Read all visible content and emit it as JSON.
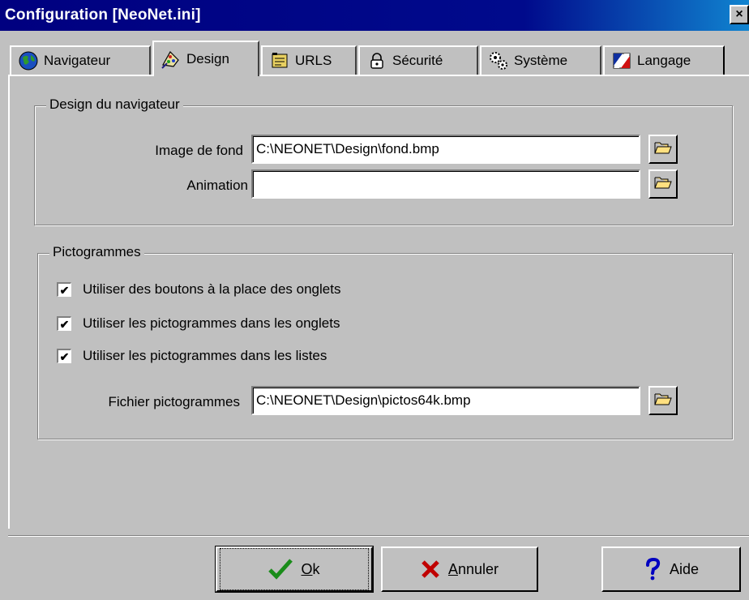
{
  "window": {
    "title": "Configuration [NeoNet.ini]",
    "close_label": "×"
  },
  "tabs": [
    {
      "label": "Navigateur",
      "icon": "globe-icon",
      "active": false
    },
    {
      "label": "Design",
      "icon": "palette-icon",
      "active": true
    },
    {
      "label": "URLS",
      "icon": "address-book-icon",
      "active": false
    },
    {
      "label": "Sécurité",
      "icon": "lock-icon",
      "active": false
    },
    {
      "label": "Système",
      "icon": "gears-icon",
      "active": false
    },
    {
      "label": "Langage",
      "icon": "flag-icon",
      "active": false
    }
  ],
  "design_group": {
    "legend": "Design du navigateur",
    "background_label": "Image de fond",
    "background_value": "C:\\NEONET\\Design\\fond.bmp",
    "animation_label": "Animation",
    "animation_value": ""
  },
  "icons_group": {
    "legend": "Pictogrammes",
    "checkboxes": [
      {
        "label": "Utiliser des boutons à la place des onglets",
        "checked": true
      },
      {
        "label": "Utiliser les pictogrammes dans les onglets",
        "checked": true
      },
      {
        "label": "Utiliser les pictogrammes dans les listes",
        "checked": true
      }
    ],
    "file_label": "Fichier pictogrammes",
    "file_value": "C:\\NEONET\\Design\\pictos64k.bmp"
  },
  "buttons": {
    "ok_mnemonic": "O",
    "ok_rest": "k",
    "cancel_mnemonic": "A",
    "cancel_rest": "nnuler",
    "help_label": "Aide"
  },
  "colors": {
    "title_bar": "#000080",
    "face": "#c0c0c0",
    "check_icon": "#1a8c1a",
    "cancel_icon": "#c00000",
    "help_icon": "#0000c0"
  }
}
